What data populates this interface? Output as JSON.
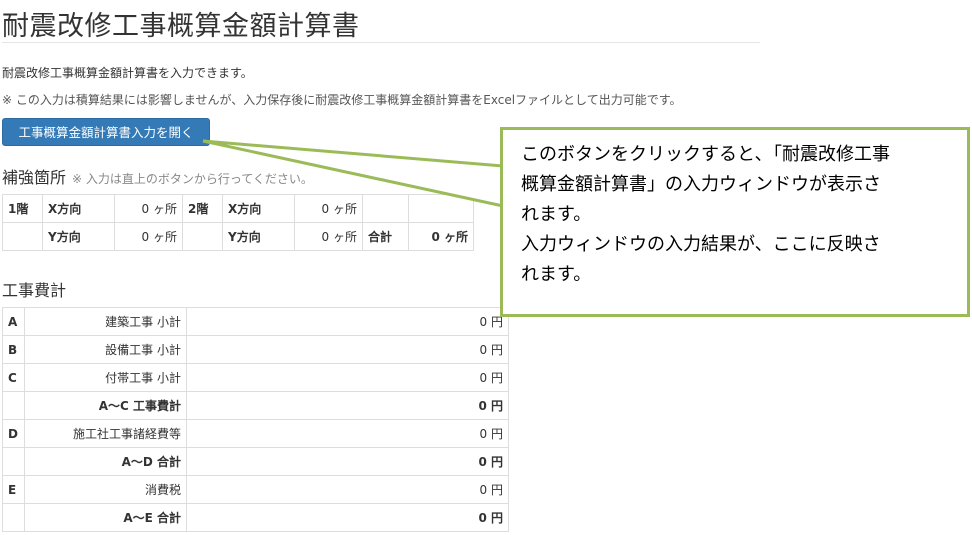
{
  "page": {
    "title": "耐震改修工事概算金額計算書",
    "intro": "耐震改修工事概算金額計算書を入力できます。",
    "note": "※ この入力は積算結果には影響しませんが、入力保存後に耐震改修工事概算金額計算書をExcelファイルとして出力可能です。",
    "open_button": "工事概算金額計算書入力を開く"
  },
  "reinforcement": {
    "heading": "補強箇所",
    "hint": "※ 入力は直上のボタンから行ってください。",
    "floor1": "1階",
    "floor2": "2階",
    "dir_x": "X方向",
    "dir_y": "Y方向",
    "f1_x": "0 ヶ所",
    "f1_y": "0 ヶ所",
    "f2_x": "0 ヶ所",
    "f2_y": "0 ヶ所",
    "total_label": "合計",
    "total_value": "0 ヶ所"
  },
  "cost": {
    "heading": "工事費計",
    "rows": [
      {
        "code": "A",
        "label": "建築工事 小計",
        "amount": "0 円"
      },
      {
        "code": "B",
        "label": "設備工事 小計",
        "amount": "0 円"
      },
      {
        "code": "C",
        "label": "付帯工事 小計",
        "amount": "0 円"
      },
      {
        "code": "",
        "label": "A～C 工事費計",
        "amount": "0 円"
      },
      {
        "code": "D",
        "label": "施工社工事諸経費等",
        "amount": "0 円"
      },
      {
        "code": "",
        "label": "A～D 合計",
        "amount": "0 円"
      },
      {
        "code": "E",
        "label": "消費税",
        "amount": "0 円"
      },
      {
        "code": "",
        "label": "A～E 合計",
        "amount": "0 円"
      }
    ]
  },
  "callout": {
    "line1": "このボタンをクリックすると､「耐震改修工事",
    "line2": "概算金額計算書」の入力ウィンドウが表示さ",
    "line3": "れます。",
    "line4": "入力ウィンドウの入力結果が、ここに反映さ",
    "line5": "れます。"
  },
  "colors": {
    "button": "#337ab7",
    "callout_border": "#9bbb59"
  }
}
